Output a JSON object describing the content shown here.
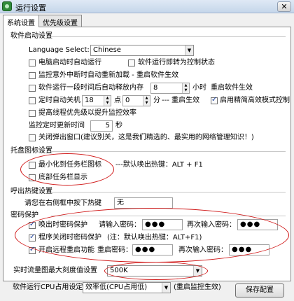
{
  "window": {
    "title": "运行设置",
    "close_glyph": "✕"
  },
  "tabs": [
    {
      "label": "系统设置",
      "active": true
    },
    {
      "label": "优先级设置",
      "active": false
    }
  ],
  "software_startup": {
    "heading": "软件启动设置",
    "language_label": "Language Select:",
    "language_value": "Chinese",
    "opt_boot_autorun": "电脑启动时自动运行",
    "opt_to_tray_on_run": "软件运行即转为控制状态",
    "opt_reload_if_abnormal": "监控意外中断时自动重新加载 - 重启软件生效",
    "opt_release_memory": "软件运行一段时间后自动释放内存",
    "release_memory_hours": "8",
    "hours_unit": "小时",
    "restart_effect_note": "重启软件生效",
    "opt_scheduled_shutdown": "定时自动关机",
    "shutdown_hour": "18",
    "hour_unit": "点",
    "shutdown_minute": "0",
    "minute_unit": "分",
    "minute_note": "--- 重启生效",
    "opt_simplified_mode": "启用精简高效模式控制",
    "opt_raise_priority": "提高线程优先级以提升监控效率",
    "monitor_interval_label": "监控定时更新时间",
    "monitor_interval_value": "5",
    "seconds_unit": "秒",
    "opt_close_popup": "关闭弹出窗口(建议别关，这是我们精选的、最实用的网络管理知识！)"
  },
  "tray": {
    "heading": "托盘图标设置",
    "opt_minimize_to_tray": "最小化到任务栏图标",
    "opt_bottom_taskbar": "底部任务栏显示",
    "hotkey_note": "---默认唤出热键：ALT + F1"
  },
  "hotkey": {
    "heading": "呼出热键设置",
    "prompt": "请您在右侧框中按下热键",
    "value": "无"
  },
  "password": {
    "heading": "密码保护",
    "opt_summon_pw": "唤出时密码保护",
    "enter_pw_label": "请输入密码：",
    "pw_value": "●●●",
    "reenter_pw_label": "再次输入密码：",
    "pw_value_2": "●●●",
    "opt_close_pw": "程序关闭时密码保护",
    "close_pw_note": "(注：默认唤出热键：ALT+F1)",
    "opt_remote_restart": "开启远程重启功能",
    "restart_pw_label": "重启密码：",
    "restart_pw_value": "●●●",
    "reenter_pw_label_2": "再次输入密码：",
    "restart_pw_value_2": "●●●"
  },
  "flow_chart": {
    "label": "实时流量图最大刻度值设置",
    "value": "500K"
  },
  "cpu": {
    "label": "软件运行CPU占用设定",
    "value": "效率低(CPU占用低)",
    "note": "(重启监控生效)"
  },
  "save_button": "保存配置",
  "annotation_color": "#d01818"
}
